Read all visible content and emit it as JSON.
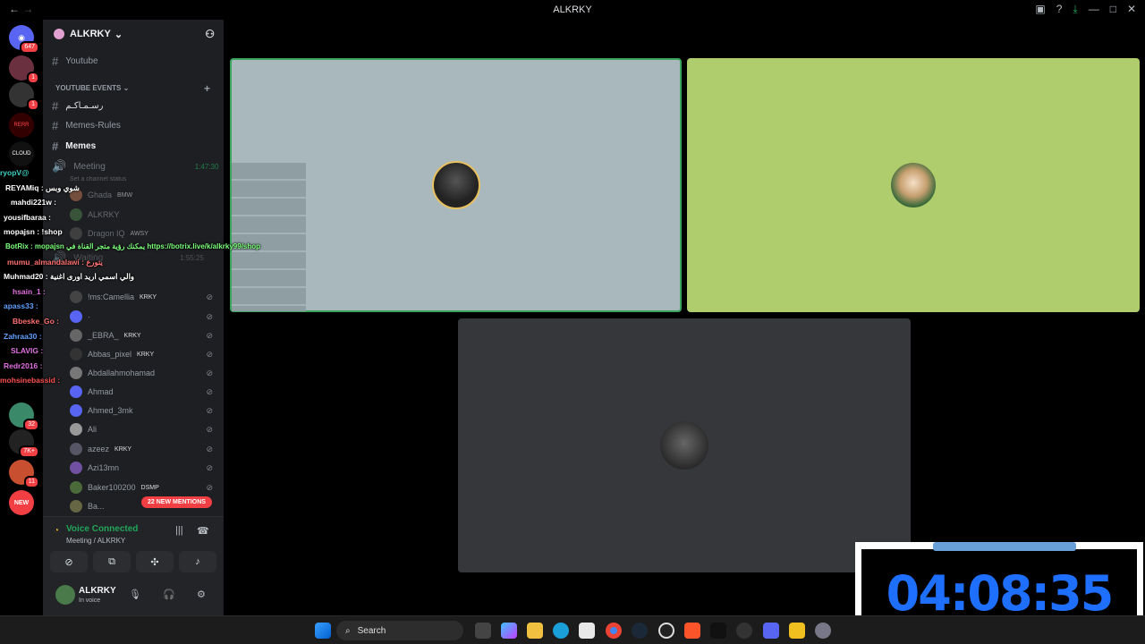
{
  "window": {
    "title": "ALKRKY"
  },
  "titlebar": {
    "back": "←",
    "forward": "→"
  },
  "guilds": {
    "home_badge": "647",
    "items": [
      {
        "badge": "1"
      },
      {
        "badge": "1"
      },
      {
        "label": "RERR"
      },
      {
        "label": "CLOUD"
      },
      {
        "badge": "32"
      },
      {
        "badge": "7K+"
      },
      {
        "badge": "11"
      },
      {
        "badge": "NEW"
      }
    ]
  },
  "server": {
    "name": "ALKRKY",
    "chevron": "⌄"
  },
  "channels": {
    "youtube": "Youtube",
    "category": "YOUTUBE EVENTS",
    "rasmakum": "رسـمـاكـم",
    "memes_rules": "Memes-Rules",
    "memes": "Memes",
    "meeting": "Meeting",
    "meeting_time": "1:47:30",
    "set_status": "Set a channel status",
    "waiting": "Waiting",
    "waiting_time": "1:55:25"
  },
  "voice_users": [
    {
      "name": "Ghada",
      "tag": "BMW",
      "color": "#b07050"
    },
    {
      "name": "ALKRKY",
      "tag": "",
      "color": "#4a7a4a"
    },
    {
      "name": "Dragon IQ",
      "tag": "AWSY",
      "color": "#555"
    },
    {
      "name": "!ms:Camellia",
      "tag": "KRKY",
      "color": "#444"
    },
    {
      "name": "·",
      "tag": "",
      "color": "#5865f2"
    },
    {
      "name": "_EBRA_",
      "tag": "KRKY",
      "color": "#666"
    },
    {
      "name": "Abbas_pixel",
      "tag": "KRKY",
      "color": "#333"
    },
    {
      "name": "Abdallahmohamad",
      "tag": "",
      "color": "#777"
    },
    {
      "name": "Ahmad",
      "tag": "",
      "color": "#5865f2"
    },
    {
      "name": "Ahmed_3mk",
      "tag": "",
      "color": "#5865f2"
    },
    {
      "name": "Ali",
      "tag": "",
      "color": "#999"
    },
    {
      "name": "azeez",
      "tag": "KRKY",
      "color": "#556"
    },
    {
      "name": "Azi13mn",
      "tag": "",
      "color": "#7050a0"
    },
    {
      "name": "Baker100200",
      "tag": "DSMP",
      "color": "#4a6a3a"
    },
    {
      "name": "Ba...",
      "tag": "KRKY",
      "color": "#664"
    }
  ],
  "mentions": "22 NEW MENTIONS",
  "voice_panel": {
    "status": "Voice Connected",
    "sub": "Meeting / ALKRKY"
  },
  "user_panel": {
    "name": "ALKRKY",
    "status": "In voice"
  },
  "chat": [
    {
      "text": "ryopV@",
      "color": "#3fd0c0"
    },
    {
      "text": "REYAMiq : شوي وبس",
      "color": "#ffffff"
    },
    {
      "text": "mahdi221w :",
      "color": "#ffffff"
    },
    {
      "text": "yousifbaraa :",
      "color": "#ffffff"
    },
    {
      "text": "mopajsn : !shop",
      "color": "#ffffff"
    },
    {
      "text": "BotRix : mopajsn يمكنك رؤية متجر القناة في https://botrix.live/k/alkrky99/shop",
      "color": "#7cff7c"
    },
    {
      "text": "mumu_almandalawi : يتورع",
      "color": "#ff7070"
    },
    {
      "text": "Muhmad20 : والي اسمي اريد اورى اغنية",
      "color": "#ffffff"
    },
    {
      "text": "hsain_1 :",
      "color": "#e070e0"
    },
    {
      "text": "apass33 :",
      "color": "#60a0ff"
    },
    {
      "text": "Bbeske_Go :",
      "color": "#ff7070"
    },
    {
      "text": "Zahraa30 :",
      "color": "#60a0ff"
    },
    {
      "text": "SLAVIG :",
      "color": "#e070e0"
    },
    {
      "text": "Redr2016 :",
      "color": "#e070e0"
    },
    {
      "text": "mohsinebassid :",
      "color": "#ff5050"
    }
  ],
  "timer": {
    "value": "04:08:35"
  },
  "taskbar": {
    "search": "Search"
  },
  "colors": {
    "tile_blue": "#a9b8bd",
    "tile_green": "#b0cd6e",
    "tile_gray": "#35373b",
    "speaking": "#3ba55d"
  }
}
